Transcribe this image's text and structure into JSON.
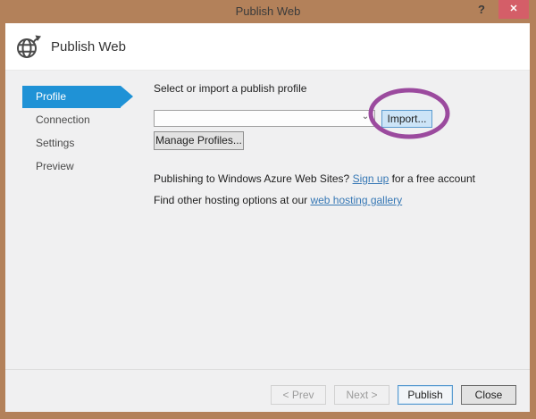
{
  "window": {
    "title": "Publish Web",
    "help_label": "?",
    "close_label": "✕",
    "frame_color": "#b3815a",
    "close_button_color": "#d45e68"
  },
  "header": {
    "title": "Publish Web",
    "icon": "globe-publish-icon"
  },
  "sidebar": {
    "selected_color": "#1f92d6",
    "items": [
      {
        "label": "Profile",
        "selected": true
      },
      {
        "label": "Connection",
        "selected": false
      },
      {
        "label": "Settings",
        "selected": false
      },
      {
        "label": "Preview",
        "selected": false
      }
    ]
  },
  "main": {
    "prompt": "Select or import a publish profile",
    "profile_dropdown": {
      "value": "",
      "chevron": "⌄"
    },
    "import_button_label": "Import...",
    "import_button_highlight_color": "#cce4f7",
    "manage_profiles_button_label": "Manage Profiles...",
    "azure_line": {
      "before": "Publishing to Windows Azure Web Sites? ",
      "link": "Sign up",
      "after": " for a free account"
    },
    "gallery_line": {
      "before": "Find other hosting options at our ",
      "link": "web hosting gallery"
    },
    "link_color": "#3778b5",
    "annotation": {
      "shape": "ellipse",
      "color": "#9b4a9e",
      "target": "import-button"
    }
  },
  "footer": {
    "prev_button": {
      "label": "< Prev",
      "state": "disabled"
    },
    "next_button": {
      "label": "Next >",
      "state": "disabled"
    },
    "publish_button": {
      "label": "Publish",
      "state": "default"
    },
    "close_button": {
      "label": "Close",
      "state": "enabled"
    }
  }
}
